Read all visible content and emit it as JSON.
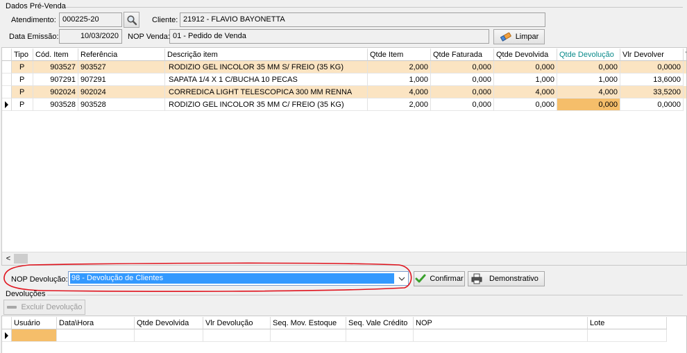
{
  "dados": {
    "group_title": "Dados Pré-Venda",
    "atendimento_label": "Atendimento:",
    "atendimento_value": "000225-20",
    "cliente_label": "Cliente:",
    "cliente_value": "21912 - FLAVIO BAYONETTA",
    "data_emissao_label": "Data Emissão:",
    "data_emissao_value": "10/03/2020",
    "nop_venda_label": "NOP Venda:",
    "nop_venda_value": "01 - Pedido de Venda",
    "limpar_label": "Limpar"
  },
  "itens": {
    "columns": [
      "Tipo",
      "Cód. Item",
      "Referência",
      "Descrição item",
      "Qtde Item",
      "Qtde Faturada",
      "Qtde Devolvida",
      "Qtde Devolução",
      "Vlr Devolver",
      "V"
    ],
    "rows": [
      [
        "P",
        "903527",
        "903527",
        "RODIZIO GEL INCOLOR 35 MM S/ FREIO (35 KG)",
        "2,000",
        "0,000",
        "0,000",
        "0,000",
        "0,0000"
      ],
      [
        "P",
        "907291",
        "907291",
        "SAPATA 1/4 X 1 C/BUCHA 10 PECAS",
        "1,000",
        "0,000",
        "1,000",
        "1,000",
        "13,6000"
      ],
      [
        "P",
        "902024",
        "902024",
        "CORREDICA LIGHT TELESCOPICA 300 MM RENNA",
        "4,000",
        "0,000",
        "4,000",
        "4,000",
        "33,5200"
      ],
      [
        "P",
        "903528",
        "903528",
        "RODIZIO GEL INCOLOR 35 MM C/ FREIO (35 KG)",
        "2,000",
        "0,000",
        "0,000",
        "0,000",
        "0,0000"
      ]
    ],
    "scroll_left": "<"
  },
  "nop_devolucao": {
    "label": "NOP Devolução:",
    "selected": "98 - Devolução de Clientes",
    "confirmar_label": "Confirmar",
    "demonstrativo_label": "Demonstrativo"
  },
  "devolucoes": {
    "group_title": "Devoluções",
    "excluir_label": "Excluir Devolução",
    "columns": [
      "Usuário",
      "Data\\Hora",
      "Qtde Devolvida",
      "Vlr Devolução",
      "Seq. Mov. Estoque",
      "Seq. Vale Crédito",
      "NOP",
      "Lote"
    ]
  },
  "colors": {
    "row_highlight": "#fbe4c2",
    "cell_focus": "#f5be6a",
    "selection": "#3399ff",
    "annotation": "#e0141e"
  }
}
